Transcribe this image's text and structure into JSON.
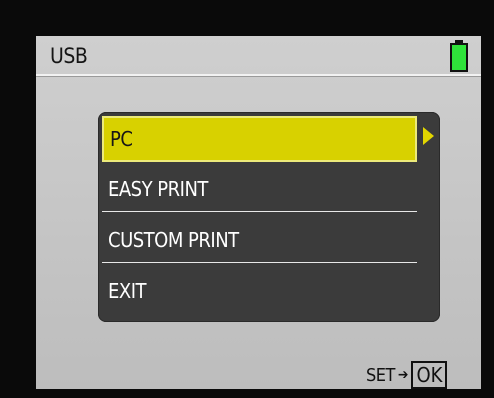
{
  "header": {
    "title": "USB"
  },
  "battery": {
    "icon": "battery-icon",
    "color": "#2fe33a"
  },
  "menu": {
    "items": [
      {
        "label": "PC",
        "selected": true
      },
      {
        "label": "EASY PRINT",
        "selected": false
      },
      {
        "label": "CUSTOM PRINT",
        "selected": false
      },
      {
        "label": "EXIT",
        "selected": false
      }
    ],
    "selected_color": "#d8d100",
    "submenu_icon": "triangle-right-icon"
  },
  "footer": {
    "set_label": "SET",
    "arrow_icon": "arrow-right-icon",
    "ok_label": "OK"
  }
}
